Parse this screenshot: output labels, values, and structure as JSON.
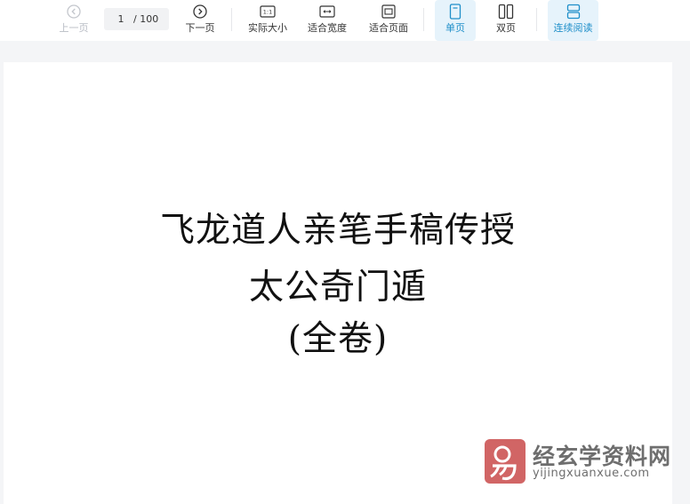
{
  "toolbar": {
    "prev_label": "上一页",
    "page_current": "1",
    "page_total": "/ 100",
    "next_label": "下一页",
    "actual_size_label": "实际大小",
    "actual_size_icon_text": "1:1",
    "fit_width_label": "适合宽度",
    "fit_page_label": "适合页面",
    "single_page_label": "单页",
    "double_page_label": "双页",
    "continuous_label": "连续阅读",
    "icons": {
      "prev": "chevron-left-circle-icon",
      "next": "chevron-right-circle-icon",
      "actual_size": "actual-size-icon",
      "fit_width": "fit-width-icon",
      "fit_page": "fit-page-icon",
      "single_page": "single-page-icon",
      "double_page": "double-page-icon",
      "continuous": "continuous-icon"
    },
    "active_color": "#1f8fc9",
    "active_bg": "#e6f3fb"
  },
  "document": {
    "title_line1": "飞龙道人亲笔手稿传授",
    "title_line2": "太公奇门遁",
    "title_line3": "(全卷)"
  },
  "watermark": {
    "site_name": "经玄学资料网",
    "site_url": "yijingxuanxue.com",
    "logo_color": "#c94a4a"
  }
}
